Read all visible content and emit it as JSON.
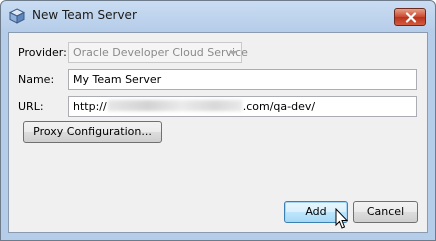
{
  "window": {
    "title": "New Team Server"
  },
  "form": {
    "provider_label": "Provider:",
    "provider_value": "Oracle Developer Cloud Service",
    "name_label": "Name:",
    "name_value": "My Team Server",
    "url_label": "URL:",
    "url_prefix": "http://",
    "url_suffix": ".com/qa-dev/",
    "proxy_button": "Proxy Configuration..."
  },
  "buttons": {
    "add": "Add",
    "cancel": "Cancel"
  },
  "colors": {
    "titlebar": "#b6cde9",
    "close_button": "#c8482f",
    "default_button_border": "#3c7fb1"
  }
}
